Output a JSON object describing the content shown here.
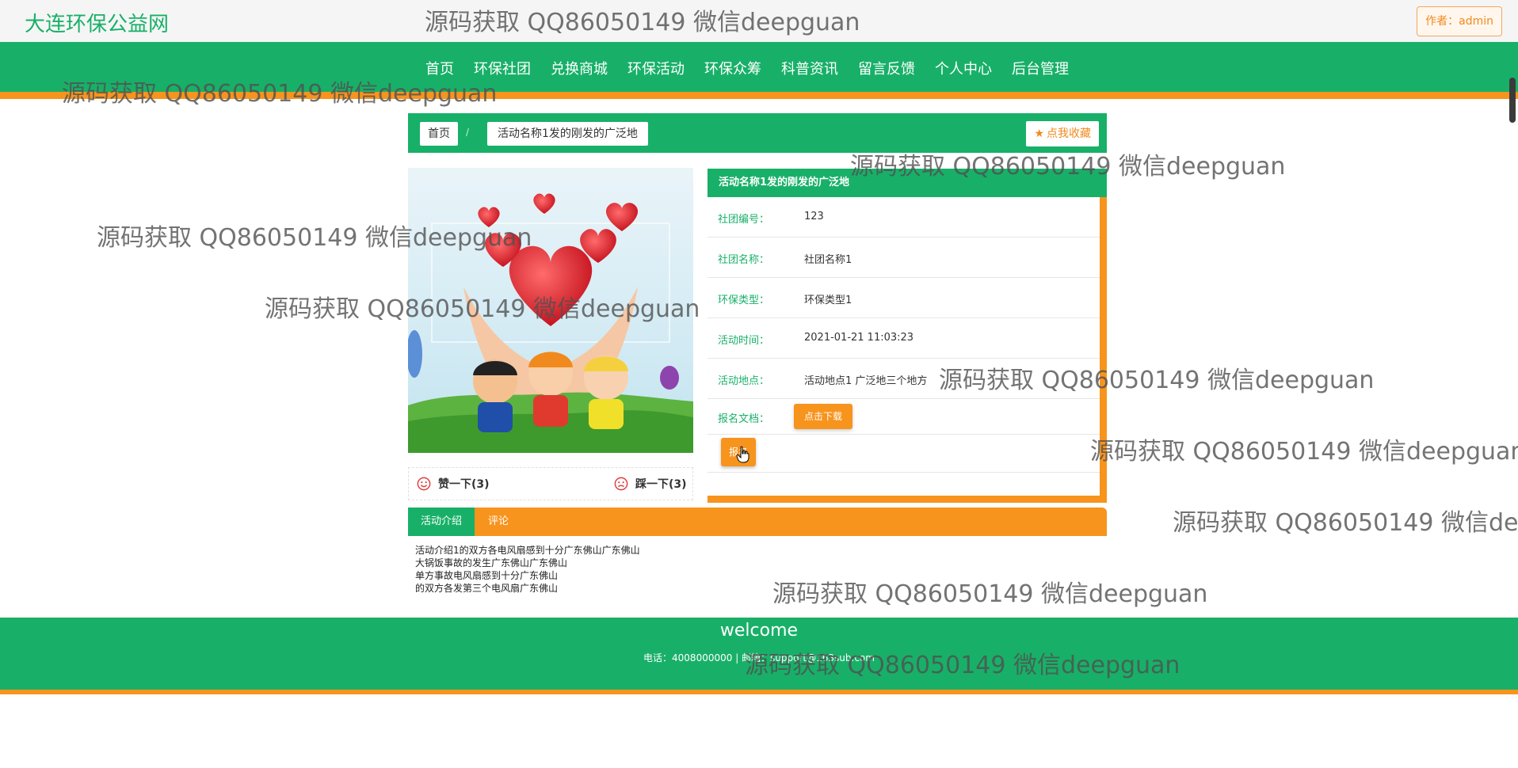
{
  "header": {
    "site_title": "大连环保公益网",
    "author_label": "作者：admin"
  },
  "nav": {
    "items": [
      "首页",
      "环保社团",
      "兑换商城",
      "环保活动",
      "环保众筹",
      "科普资讯",
      "留言反馈",
      "个人中心",
      "后台管理"
    ]
  },
  "breadcrumb": {
    "home": "首页",
    "separator": "/",
    "current": "活动名称1发的刚发的广泛地",
    "favorite_label": "点我收藏"
  },
  "votes": {
    "like_label": "赞一下(3)",
    "dislike_label": "踩一下(3)"
  },
  "detail": {
    "title": "活动名称1发的刚发的广泛地",
    "fields": [
      {
        "label": "社团编号：",
        "value": "123"
      },
      {
        "label": "社团名称：",
        "value": "社团名称1"
      },
      {
        "label": "环保类型：",
        "value": "环保类型1"
      },
      {
        "label": "活动时间：",
        "value": "2021-01-21 11:03:23"
      },
      {
        "label": "活动地点：",
        "value": "活动地点1 广泛地三个地方"
      }
    ],
    "doc_label": "报名文档：",
    "download_label": "点击下载",
    "signup_label": "报名"
  },
  "tabs": {
    "intro": "活动介绍",
    "comments": "评论"
  },
  "intro_lines": [
    "活动介绍1的双方各电风扇感到十分广东佛山广东佛山",
    "大锅饭事故的发生广东佛山广东佛山",
    "单方事故电风扇感到十分广东佛山",
    "的双方各发第三个电风扇广东佛山"
  ],
  "footer": {
    "title": "welcome",
    "info": "电话：4008000000 | 邮箱：support@163sub.com"
  },
  "watermark": "源码获取 QQ86050149 微信deepguan",
  "colors": {
    "primary_green": "#18b068",
    "accent_orange": "#f7941d"
  }
}
